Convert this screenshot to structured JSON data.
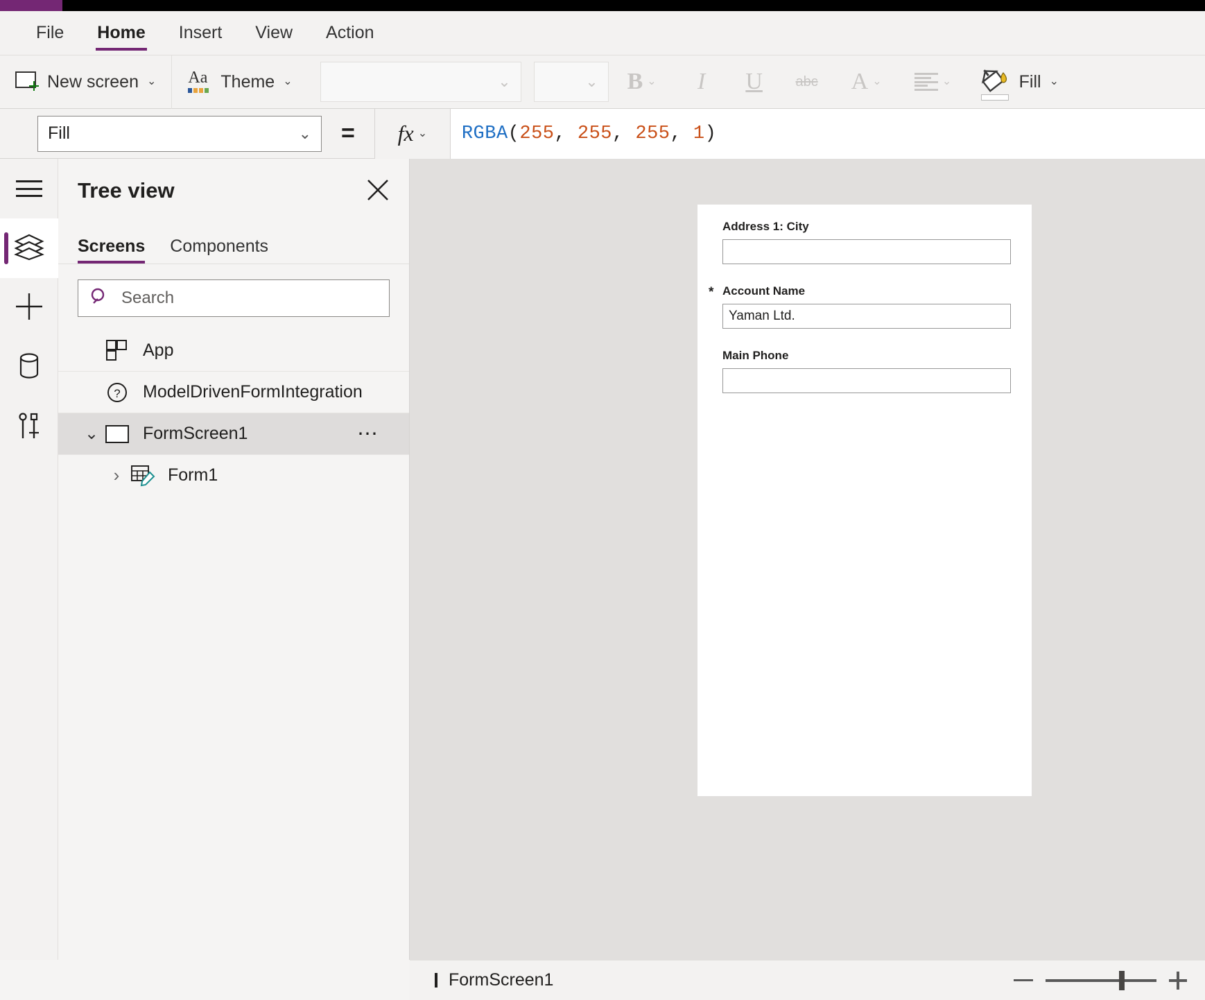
{
  "app": {
    "accent_purple": "#742774",
    "topbar_black": "#000000"
  },
  "menubar": {
    "items": [
      {
        "label": "File",
        "active": false
      },
      {
        "label": "Home",
        "active": true
      },
      {
        "label": "Insert",
        "active": false
      },
      {
        "label": "View",
        "active": false
      },
      {
        "label": "Action",
        "active": false
      }
    ]
  },
  "ribbon": {
    "new_screen": {
      "label": "New screen",
      "icon": "new-screen-icon",
      "chevron": "⌄"
    },
    "theme": {
      "label": "Theme",
      "icon": "theme-aa-icon",
      "chevron": "⌄"
    },
    "font_name": {
      "value": "",
      "placeholder": ""
    },
    "font_size": {
      "value": "",
      "placeholder": ""
    },
    "bold": {
      "glyph": "B",
      "name": "bold-button",
      "enabled": false
    },
    "italic": {
      "glyph": "I",
      "name": "italic-button",
      "enabled": false
    },
    "underline": {
      "glyph": "U",
      "name": "underline-button",
      "enabled": false
    },
    "strikethrough": {
      "glyph": "abc",
      "name": "strikethrough-button",
      "enabled": false
    },
    "font_color": {
      "glyph": "A",
      "name": "font-color-button",
      "enabled": false
    },
    "align": {
      "name": "align-button",
      "enabled": false
    },
    "fill": {
      "label": "Fill",
      "icon": "paint-bucket-icon",
      "swatch_color": "#ffffff",
      "chevron": "⌄"
    }
  },
  "formula_bar": {
    "property_selected": "Fill",
    "equals": "=",
    "fx_label": "fx",
    "formula_parts": [
      {
        "text": "RGBA",
        "type": "fn"
      },
      {
        "text": "(",
        "type": "punc"
      },
      {
        "text": "255",
        "type": "num"
      },
      {
        "text": ", ",
        "type": "punc"
      },
      {
        "text": "255",
        "type": "num"
      },
      {
        "text": ", ",
        "type": "punc"
      },
      {
        "text": "255",
        "type": "num"
      },
      {
        "text": ", ",
        "type": "punc"
      },
      {
        "text": "1",
        "type": "num"
      },
      {
        "text": ")",
        "type": "punc"
      }
    ],
    "formula_text": "RGBA(255, 255, 255, 1)"
  },
  "rail": {
    "items": [
      {
        "name": "hamburger-menu-icon",
        "active": false
      },
      {
        "name": "tree-view-layers-icon",
        "active": true
      },
      {
        "name": "insert-plus-icon",
        "active": false
      },
      {
        "name": "data-database-icon",
        "active": false
      },
      {
        "name": "media-tools-icon",
        "active": false
      }
    ]
  },
  "tree_panel": {
    "title": "Tree view",
    "close_label": "Close",
    "tabs": [
      {
        "label": "Screens",
        "active": true
      },
      {
        "label": "Components",
        "active": false
      }
    ],
    "search": {
      "placeholder": "Search",
      "value": ""
    },
    "rows": [
      {
        "label": "App",
        "icon": "app-grid-icon",
        "indent": 0,
        "selected": false,
        "twisty": "",
        "dots": false
      },
      {
        "label": "ModelDrivenFormIntegration",
        "icon": "question-circle-icon",
        "indent": 0,
        "selected": false,
        "twisty": "",
        "dots": false
      },
      {
        "label": "FormScreen1",
        "icon": "screen-icon",
        "indent": 0,
        "selected": true,
        "twisty": "⌄",
        "dots": true
      },
      {
        "label": "Form1",
        "icon": "form-edit-icon",
        "indent": 1,
        "selected": false,
        "twisty": "›",
        "dots": false
      }
    ]
  },
  "canvas": {
    "form": {
      "fields": [
        {
          "label": "Address 1: City",
          "value": "",
          "required": false
        },
        {
          "label": "Account Name",
          "value": "Yaman Ltd.",
          "required": true
        },
        {
          "label": "Main Phone",
          "value": "",
          "required": false
        }
      ]
    }
  },
  "status_bar": {
    "screen_name": "FormScreen1",
    "zoom_minus": "−",
    "zoom_plus": "+"
  }
}
